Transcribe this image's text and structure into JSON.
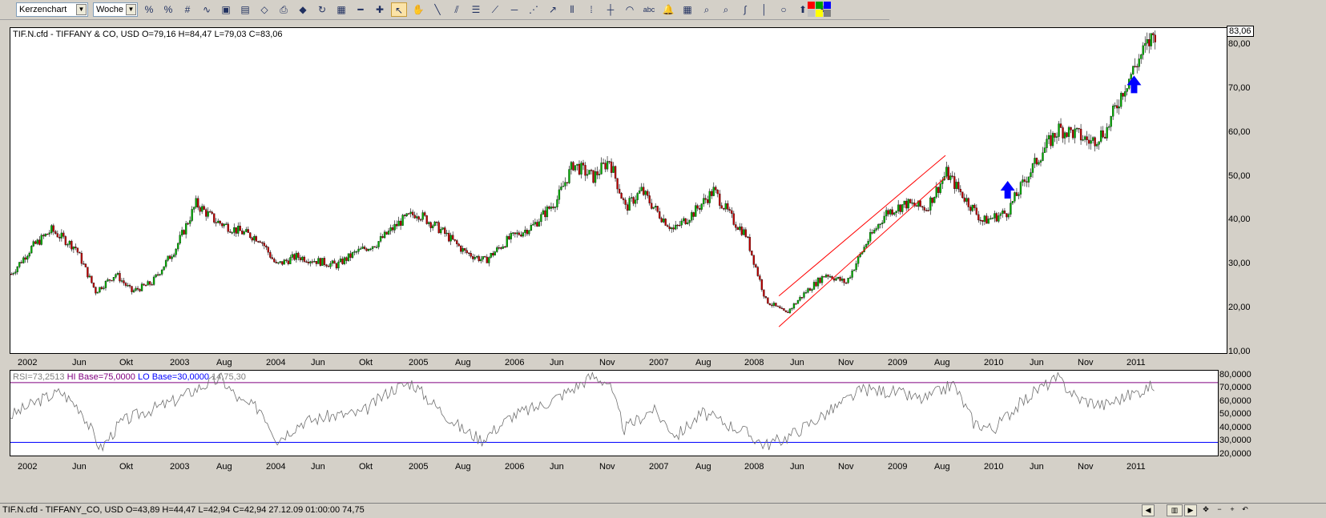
{
  "toolbar": {
    "chart_type": "Kerzenchart",
    "period": "Woche",
    "tools": [
      {
        "name": "indicator-icon",
        "glyph": "%"
      },
      {
        "name": "indicator2-icon",
        "glyph": "%"
      },
      {
        "name": "grid-icon",
        "glyph": "#"
      },
      {
        "name": "line-chart-icon",
        "glyph": "∿"
      },
      {
        "name": "save-image-icon",
        "glyph": "▣"
      },
      {
        "name": "window-icon",
        "glyph": "▤"
      },
      {
        "name": "eraser-icon",
        "glyph": "◇"
      },
      {
        "name": "print-icon",
        "glyph": "⎙"
      },
      {
        "name": "color-icon",
        "glyph": "◆"
      },
      {
        "name": "refresh-icon",
        "glyph": "↻"
      },
      {
        "name": "properties-icon",
        "glyph": "▦"
      },
      {
        "name": "zoom-out-icon",
        "glyph": "━"
      },
      {
        "name": "zoom-in-icon",
        "glyph": "✚"
      },
      {
        "name": "pointer-icon",
        "glyph": "↖"
      },
      {
        "name": "hand-icon",
        "glyph": "✋"
      },
      {
        "name": "trendline-icon",
        "glyph": "╲"
      },
      {
        "name": "parallel-lines-icon",
        "glyph": "⫽"
      },
      {
        "name": "fibonacci-icon",
        "glyph": "☰"
      },
      {
        "name": "fan-icon",
        "glyph": "⟋"
      },
      {
        "name": "horizontal-line-icon",
        "glyph": "─"
      },
      {
        "name": "gann-fan-icon",
        "glyph": "⋰"
      },
      {
        "name": "speed-lines-icon",
        "glyph": "↗"
      },
      {
        "name": "cycle-lines-icon",
        "glyph": "⦀"
      },
      {
        "name": "vertical-lines-icon",
        "glyph": "⁞"
      },
      {
        "name": "crosshair-icon",
        "glyph": "┼"
      },
      {
        "name": "arc-icon",
        "glyph": "◠"
      },
      {
        "name": "text-icon",
        "glyph": "abc"
      },
      {
        "name": "alarm-bell-icon",
        "glyph": "🔔"
      },
      {
        "name": "calculator-icon",
        "glyph": "▦"
      },
      {
        "name": "zoom-icon",
        "glyph": "⌕"
      },
      {
        "name": "zoom-area-icon",
        "glyph": "⌕"
      },
      {
        "name": "freehand-icon",
        "glyph": "∫"
      },
      {
        "name": "separator-icon",
        "glyph": "│"
      },
      {
        "name": "circle-icon",
        "glyph": "○"
      },
      {
        "name": "arrow-up-icon",
        "glyph": "⬆"
      },
      {
        "name": "arrow-down-icon",
        "glyph": "⬇"
      }
    ]
  },
  "chart_data": [
    {
      "type": "candlestick",
      "title": "TIF.N.cfd - TIFFANY & CO, USD O=79,16 H=84,47 L=79,03 C=83,06",
      "last_value_label": "83,06",
      "y_ticks": [
        "10,00",
        "20,00",
        "30,00",
        "40,00",
        "50,00",
        "60,00",
        "70,00",
        "80,00"
      ],
      "ylim": [
        10,
        84
      ],
      "x_labels": [
        "2002",
        "Jun",
        "Okt",
        "2003",
        "Aug",
        "2004",
        "Jun",
        "Okt",
        "2005",
        "Aug",
        "2006",
        "Jun",
        "Nov",
        "2007",
        "Aug",
        "2008",
        "Jun",
        "Nov",
        "2009",
        "Aug",
        "2010",
        "Jun",
        "Nov",
        "2011"
      ],
      "anchors": [
        [
          0,
          28
        ],
        [
          10,
          34
        ],
        [
          20,
          38
        ],
        [
          32,
          34
        ],
        [
          42,
          24
        ],
        [
          52,
          28
        ],
        [
          60,
          24
        ],
        [
          70,
          26
        ],
        [
          82,
          34
        ],
        [
          92,
          44
        ],
        [
          102,
          40
        ],
        [
          112,
          38
        ],
        [
          124,
          36
        ],
        [
          132,
          30
        ],
        [
          142,
          32
        ],
        [
          152,
          31
        ],
        [
          162,
          30
        ],
        [
          172,
          33
        ],
        [
          182,
          35
        ],
        [
          194,
          40
        ],
        [
          202,
          42
        ],
        [
          214,
          38
        ],
        [
          226,
          33
        ],
        [
          236,
          31
        ],
        [
          248,
          36
        ],
        [
          260,
          39
        ],
        [
          272,
          45
        ],
        [
          280,
          53
        ],
        [
          290,
          50
        ],
        [
          298,
          54
        ],
        [
          306,
          43
        ],
        [
          314,
          47
        ],
        [
          322,
          42
        ],
        [
          330,
          38
        ],
        [
          340,
          42
        ],
        [
          350,
          47
        ],
        [
          360,
          40
        ],
        [
          366,
          37
        ],
        [
          376,
          22
        ],
        [
          386,
          19
        ],
        [
          396,
          24
        ],
        [
          406,
          28
        ],
        [
          416,
          26
        ],
        [
          426,
          35
        ],
        [
          436,
          42
        ],
        [
          446,
          44
        ],
        [
          456,
          43
        ],
        [
          466,
          51
        ],
        [
          474,
          46
        ],
        [
          484,
          40
        ],
        [
          496,
          42
        ],
        [
          506,
          50
        ],
        [
          514,
          56
        ],
        [
          522,
          61
        ],
        [
          530,
          60
        ],
        [
          538,
          58
        ],
        [
          546,
          61
        ],
        [
          554,
          70
        ],
        [
          562,
          77
        ],
        [
          570,
          83
        ]
      ],
      "candle_count": 571,
      "channel_lines": [
        [
          [
            383,
            23
          ],
          [
            466,
            55
          ]
        ],
        [
          [
            383,
            16
          ],
          [
            466,
            50
          ]
        ]
      ],
      "color_up": "#00b000",
      "color_down": "#c00000",
      "channel_color": "#ff0000",
      "arrow_color": "#0000ff",
      "arrows": [
        [
          497,
          47
        ],
        [
          560,
          71
        ]
      ]
    },
    {
      "type": "line",
      "title": "RSI=73,2513",
      "hi_label": "HI Base=75,0000",
      "lo_label": "LO Base=30,0000",
      "params": "14,75,30",
      "y_ticks": [
        "20,0000",
        "30,0000",
        "40,0000",
        "50,0000",
        "60,0000",
        "70,0000",
        "80,0000"
      ],
      "ylim": [
        20,
        84
      ],
      "hi": 75,
      "lo": 30,
      "hi_color": "#800080",
      "lo_color": "#0000ff",
      "anchors": [
        [
          0,
          50
        ],
        [
          15,
          62
        ],
        [
          25,
          68
        ],
        [
          35,
          55
        ],
        [
          45,
          25
        ],
        [
          55,
          45
        ],
        [
          65,
          52
        ],
        [
          80,
          60
        ],
        [
          95,
          72
        ],
        [
          105,
          78
        ],
        [
          115,
          60
        ],
        [
          125,
          55
        ],
        [
          133,
          32
        ],
        [
          145,
          45
        ],
        [
          160,
          50
        ],
        [
          175,
          52
        ],
        [
          190,
          70
        ],
        [
          200,
          75
        ],
        [
          210,
          60
        ],
        [
          225,
          40
        ],
        [
          235,
          32
        ],
        [
          250,
          50
        ],
        [
          265,
          58
        ],
        [
          280,
          70
        ],
        [
          290,
          80
        ],
        [
          298,
          75
        ],
        [
          306,
          40
        ],
        [
          320,
          55
        ],
        [
          332,
          35
        ],
        [
          345,
          52
        ],
        [
          360,
          42
        ],
        [
          366,
          38
        ],
        [
          376,
          28
        ],
        [
          386,
          33
        ],
        [
          396,
          42
        ],
        [
          410,
          55
        ],
        [
          425,
          70
        ],
        [
          440,
          68
        ],
        [
          455,
          62
        ],
        [
          470,
          74
        ],
        [
          480,
          45
        ],
        [
          490,
          40
        ],
        [
          500,
          55
        ],
        [
          512,
          70
        ],
        [
          522,
          78
        ],
        [
          532,
          63
        ],
        [
          545,
          58
        ],
        [
          560,
          67
        ],
        [
          570,
          73
        ]
      ]
    }
  ],
  "date_axis": {
    "labels": [
      "2002",
      "Jun",
      "Okt",
      "2003",
      "Aug",
      "2004",
      "Jun",
      "Okt",
      "2005",
      "Aug",
      "2006",
      "Jun",
      "Nov",
      "2007",
      "Aug",
      "2008",
      "Jun",
      "Nov",
      "2009",
      "Aug",
      "2010",
      "Jun",
      "Nov",
      "2011"
    ]
  },
  "status": {
    "text": "TIF.N.cfd - TIFFANY_CO, USD O=43,89 H=44,47 L=42,94 C=42,94  27.12.09 01:00:00 74,75"
  }
}
